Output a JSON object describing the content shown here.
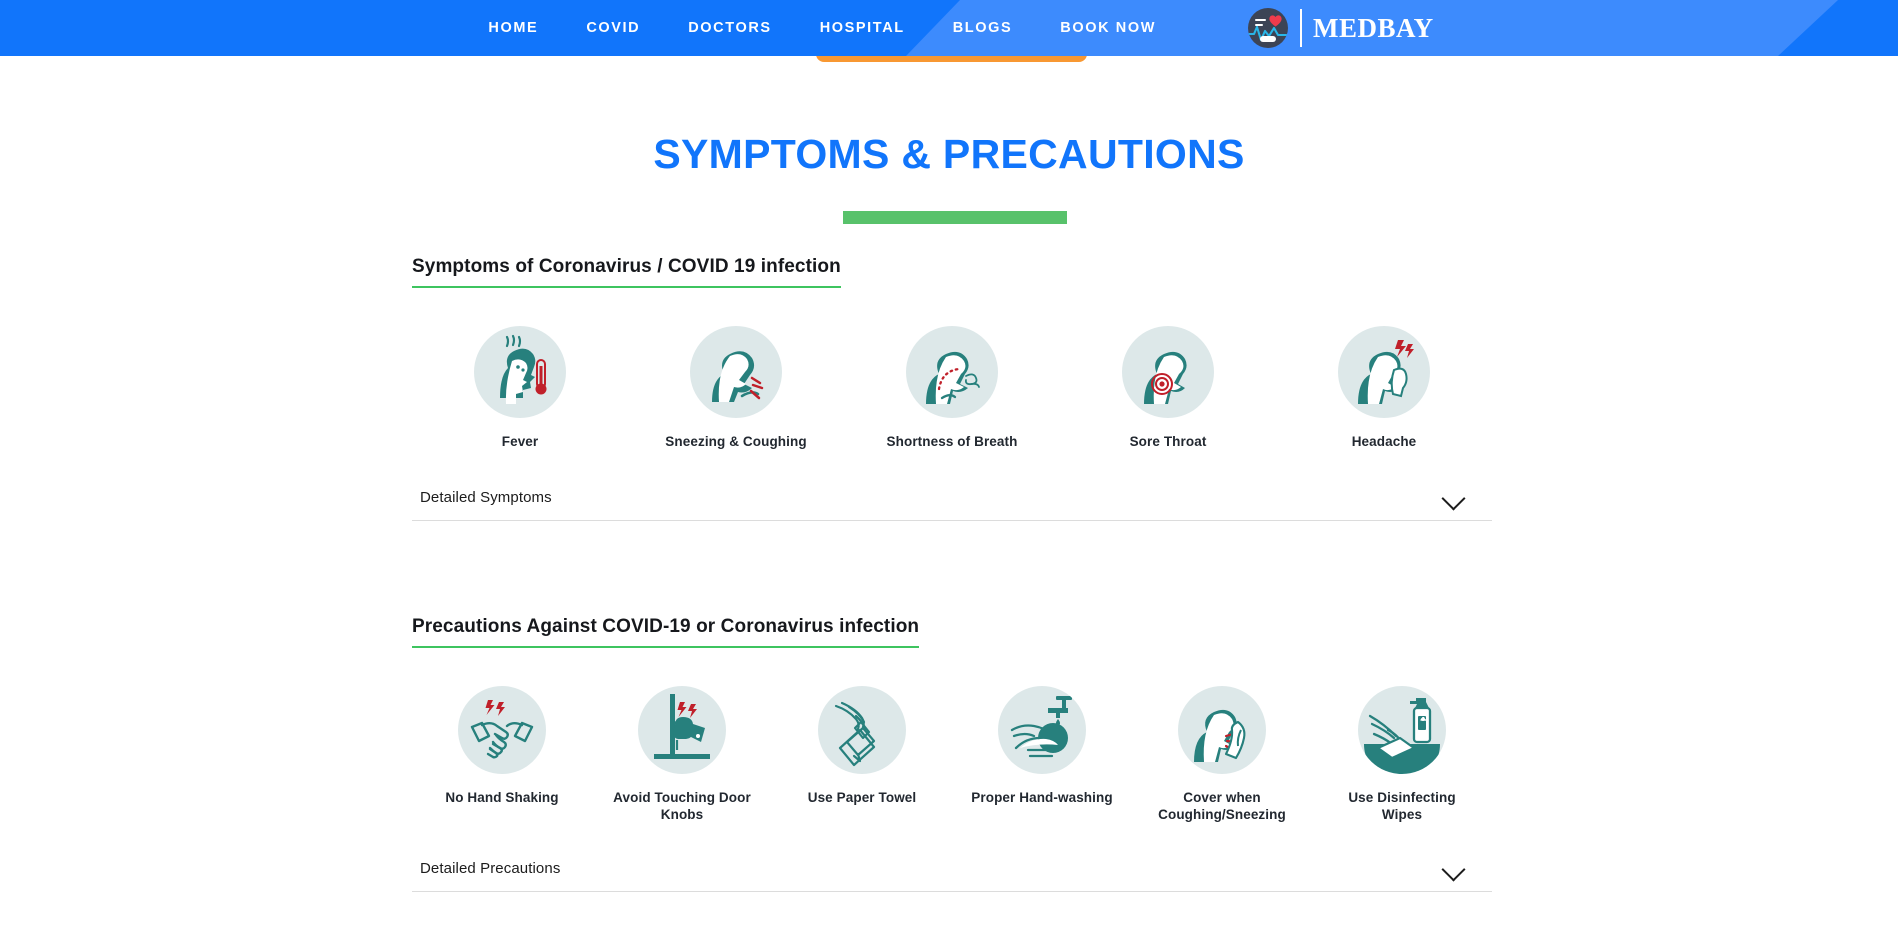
{
  "nav": {
    "links": [
      {
        "label": "HOME",
        "name": "nav-link-home"
      },
      {
        "label": "COVID",
        "name": "nav-link-covid"
      },
      {
        "label": "DOCTORS",
        "name": "nav-link-doctors"
      },
      {
        "label": "HOSPITAL",
        "name": "nav-link-hospital"
      },
      {
        "label": "BLOGS",
        "name": "nav-link-blogs"
      },
      {
        "label": "BOOK NOW",
        "name": "nav-link-book-now"
      }
    ],
    "brand": "MEDBAY",
    "colors": {
      "nav_primary": "#1175fb",
      "nav_secondary": "#3d8bfd",
      "logo_disc": "#3c4455",
      "logo_heart": "#ef3b4c"
    }
  },
  "hero": {
    "title_left": "SYMPTO",
    "title_mid": "MS & PRECA",
    "title_right": "UTIONS",
    "title_full": "SYMPTOMS & PRECAUTIONS",
    "title_color": "#1175fb",
    "highlight_color": "#58c26b",
    "accent_bar_color": "#f89832"
  },
  "symptoms_section": {
    "heading": "Symptoms of Coronavirus / COVID 19 infection",
    "underline_color": "#3ec45f",
    "items": [
      {
        "label": "Fever",
        "icon": "fever-thermometer-icon"
      },
      {
        "label": "Sneezing & Coughing",
        "icon": "sneezing-coughing-icon"
      },
      {
        "label": "Shortness of Breath",
        "icon": "shortness-of-breath-icon"
      },
      {
        "label": "Sore Throat",
        "icon": "sore-throat-icon"
      },
      {
        "label": "Headache",
        "icon": "headache-icon"
      }
    ],
    "accordion_label": "Detailed Symptoms"
  },
  "precautions_section": {
    "heading": "Precautions Against COVID-19 or Coronavirus infection",
    "underline_color": "#3ec45f",
    "items": [
      {
        "label": "No Hand Shaking",
        "icon": "no-handshake-icon"
      },
      {
        "label": "Avoid Touching Door Knobs",
        "icon": "door-knob-icon"
      },
      {
        "label": "Use Paper Towel",
        "icon": "paper-towel-icon"
      },
      {
        "label": "Proper Hand-washing",
        "icon": "hand-washing-icon"
      },
      {
        "label": "Cover when Coughing/Sneezing",
        "icon": "cover-cough-icon"
      },
      {
        "label": "Use Disinfecting Wipes",
        "icon": "disinfecting-wipes-icon"
      }
    ],
    "accordion_label": "Detailed Precautions"
  },
  "icon_theme": {
    "circle_bg": "#dde8e9",
    "figure": "#27807d",
    "alert": "#c0202a"
  }
}
